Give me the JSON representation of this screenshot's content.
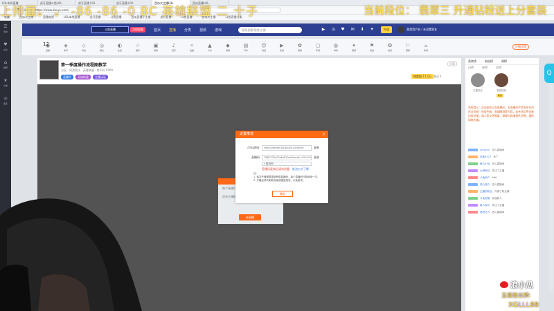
{
  "browser": {
    "tabs": [
      "LOL本局直播",
      "虎牙直播斗鱼LOL",
      "虎牙直播 LOL",
      "虎牙直播 LOL",
      "西瓜大主播LOL",
      "西瓜直播LOL"
    ],
    "url": "https://www.douyu.com/",
    "bookmarks": [
      "收藏",
      "西瓜大主播",
      "直播电视",
      "LOL本地直播",
      "虎牙直播",
      "斗鱼直播",
      "西瓜直播小主播",
      "虎牙直播",
      "斗鱼直播",
      "西瓜大主播",
      "斗鱼直播分类"
    ]
  },
  "overlay": {
    "left": "上排面。 。 -86 -86 -0 BC 英雄联盟 二 十子",
    "right": "当前段位： 翡翠三 升通钻粉送上分套装"
  },
  "header": {
    "logo": "斗鱼直播",
    "logo_badge": "为你而来",
    "nav": [
      "首页",
      "直播",
      "分类",
      "视频",
      "游戏"
    ],
    "active_nav": "直播",
    "search_placeholder": "搜索直播/视频/主播",
    "icons": [
      "开播",
      "历史",
      "关注",
      "消息",
      "下载",
      "鱼吧"
    ],
    "icon_glyphs": [
      "▶",
      "◷",
      "♥",
      "✉",
      "⬇",
      "✦"
    ],
    "upgrade": "升级",
    "username": "我是用户名 / 未设置签名"
  },
  "sidebar": [
    {
      "icon": "☰",
      "label": "导航"
    },
    {
      "icon": "♥",
      "label": "关注"
    },
    {
      "icon": "⌂",
      "label": "推荐"
    },
    {
      "icon": "★",
      "label": "分类"
    },
    {
      "icon": "◎",
      "label": "更多"
    }
  ],
  "level": "12",
  "categories": [
    "直播",
    "体育",
    "科技",
    "美食",
    "生活",
    "娱乐",
    "游戏",
    "音乐",
    "舞蹈",
    "户外",
    "旅游",
    "汽车",
    "动漫",
    "影视",
    "宠物",
    "手游",
    "单机",
    "网游",
    "竞技",
    "电竞",
    "赛事",
    "休闲",
    "棋牌",
    "颜值",
    "星秀",
    "二次元",
    "语音",
    "知识"
  ],
  "category_right": "开播设置",
  "room": {
    "title": "第一季度操作流程图教学",
    "meta": "分区：网游竞技 · 英雄联盟 · 房间号 9999",
    "tags": [
      "直播中",
      "英雄联盟",
      "主播认证"
    ],
    "tag_colors": [
      "#2f7be4",
      "#a24fcf",
      "#7a5ae0"
    ],
    "hot": "热度值 11.1万",
    "hot2": "关注 1",
    "share": "分享"
  },
  "modal": {
    "title": "设置推流",
    "close": "×",
    "rows": [
      {
        "label": "rtmp地址",
        "value": "rtmp://sendtc3a.douyu.com/live",
        "action": "复制"
      },
      {
        "label": "直播码",
        "value": "7865705rV7a4f4Q?wsSecret=********",
        "action": "复制"
      }
    ],
    "select": "* 推流码",
    "link_red": "直播码复制后请勿泄露",
    "link_blue": "推流方式了解",
    "notes": [
      "注：",
      "1. 每次开播需要重新获取直播码，每个直播码只能使用一次。",
      "2. 开播后请勿刷新页面或重复推流，以免断流。"
    ],
    "ok": "确定"
  },
  "popup2": {
    "text": "每个直播间只允许一个推流设备同时推流",
    "sub": "没有主播推流",
    "button": "去直播"
  },
  "right_panel": {
    "tabs": [
      "贵宾榜",
      "粉丝榜",
      "周榜"
    ],
    "sub": [
      "日榜",
      "周榜",
      "总榜"
    ],
    "ranks": [
      {
        "name": "主播好友",
        "badge": ""
      },
      {
        "name": "老铁铁粉",
        "badge": "粉丝"
      }
    ],
    "notice": "系统提示：欢迎来到斗鱼直播间，本直播间严禁发布任何违法违规、低俗色情、吸烟酗酒等内容，若有违反将会被封禁处理，请大家文明观看。弹幕礼物请理性消费，谨防网络诈骗。",
    "chat": [
      {
        "name": "xingyun",
        "text": "进入直播间"
      },
      {
        "name": "游客9527",
        "text": "来了"
      },
      {
        "name": "鱼丸小仙",
        "text": "进入直播间"
      },
      {
        "name": "大神粉丝",
        "text": "关注了主播"
      },
      {
        "name": "斗鱼用户",
        "text": "666"
      },
      {
        "name": "热心观众",
        "text": "进入直播间"
      },
      {
        "name": "主播的粉丝",
        "text": "开通了粉丝牌"
      },
      {
        "name": "斗鱼房管",
        "text": "欢迎新人"
      },
      {
        "name": "新人观众",
        "text": "关注了主播"
      },
      {
        "name": "鱼吧达人",
        "text": "进入直播间"
      }
    ],
    "chat_colors": [
      "#7fb2ff",
      "#ffb36b",
      "#7fd18b",
      "#c58cff",
      "#ff8a8a",
      "#7fb2ff",
      "#ffb36b",
      "#7fd18b",
      "#c58cff",
      "#ff8a8a"
    ]
  },
  "mascot": "Q",
  "watermark": {
    "logo": "浪小瓜",
    "line1": "五级粉丝牌:",
    "line2": "XGLLL88"
  }
}
